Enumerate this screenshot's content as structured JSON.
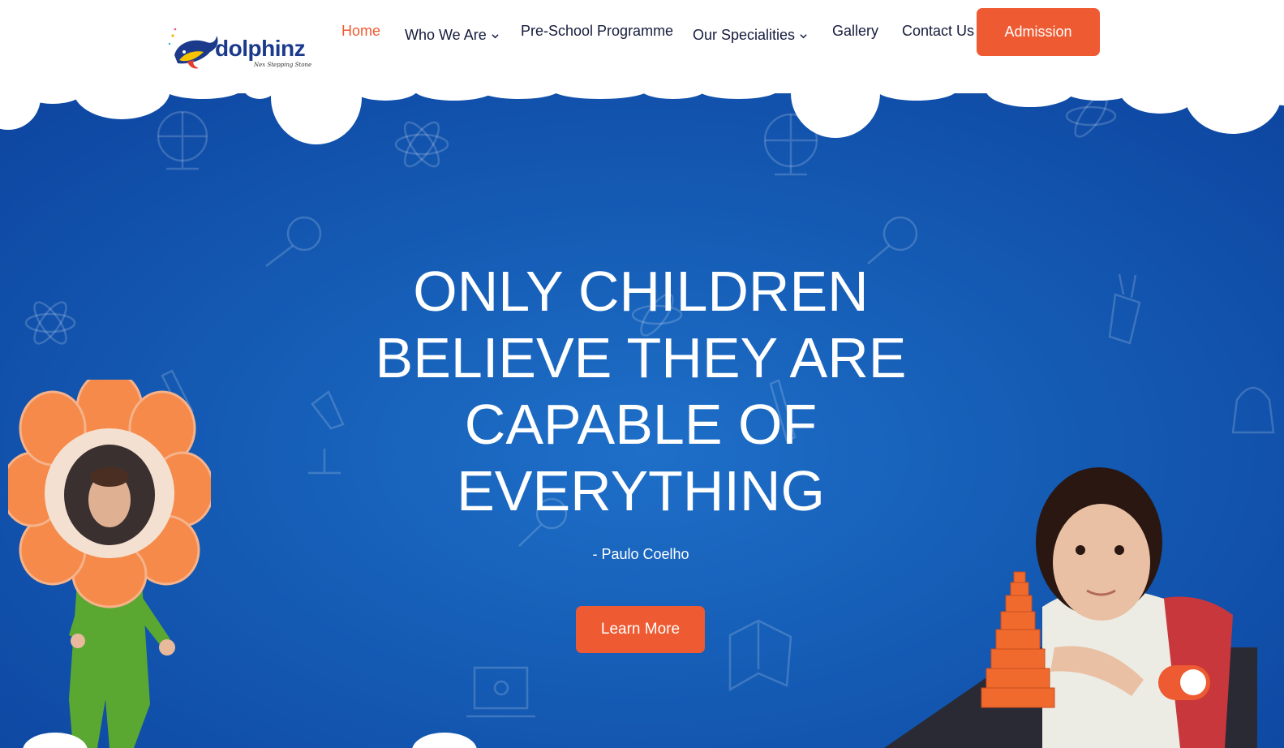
{
  "brand": {
    "name": "dolphinz",
    "tagline": "Nex Stepping Stone"
  },
  "nav": {
    "home": "Home",
    "who_we_are": "Who We Are",
    "preschool": "Pre-School Programme",
    "specialities": "Our Specialities",
    "gallery": "Gallery",
    "contact": "Contact Us",
    "admission": "Admission"
  },
  "hero": {
    "quote_line1": "ONLY CHILDREN",
    "quote_line2": "BELIEVE THEY ARE",
    "quote_line3": "CAPABLE OF",
    "quote_line4": "EVERYTHING",
    "author": "- Paulo Coelho",
    "cta": "Learn More"
  },
  "colors": {
    "accent": "#ee5a31",
    "hero_blue": "#155cb5",
    "nav_text": "#161c3d",
    "logo_blue": "#1b3a8c"
  }
}
